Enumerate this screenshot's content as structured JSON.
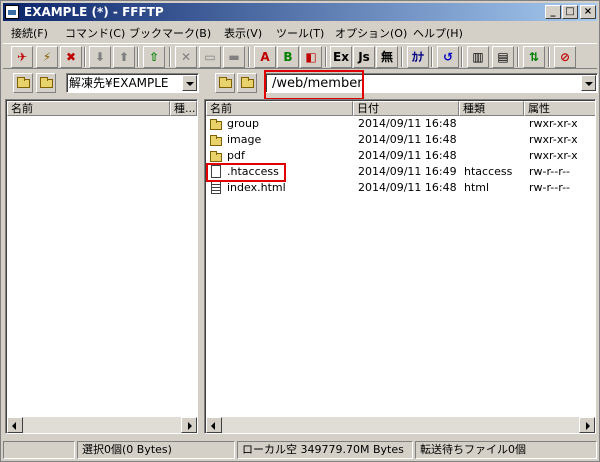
{
  "window": {
    "title": "EXAMPLE (*) - FFFTP"
  },
  "menu": [
    "接続(F)",
    "コマンド(C)",
    "ブックマーク(B)",
    "表示(V)",
    "ツール(T)",
    "オプション(O)",
    "ヘルプ(H)"
  ],
  "toolbar": {
    "buttons": [
      {
        "name": "connect-icon",
        "glyph": "✈",
        "color": "#c00000"
      },
      {
        "name": "quick-connect-icon",
        "glyph": "⚡",
        "color": "#806000"
      },
      {
        "name": "disconnect-icon",
        "glyph": "✖",
        "color": "#c00000"
      },
      {
        "name": "download-icon",
        "glyph": "⬇",
        "color": "#808080"
      },
      {
        "name": "upload-icon",
        "glyph": "⬆",
        "color": "#808080"
      },
      {
        "name": "mirror-upload-icon",
        "glyph": "⇧",
        "color": "#008000"
      },
      {
        "name": "delete-icon",
        "glyph": "✕",
        "color": "#808080"
      },
      {
        "name": "rename-icon",
        "glyph": "▭",
        "color": "#808080"
      },
      {
        "name": "new-folder-icon",
        "glyph": "▬",
        "color": "#808080"
      },
      {
        "name": "ascii-mode-icon",
        "glyph": "A",
        "color": "#c00000"
      },
      {
        "name": "binary-mode-icon",
        "glyph": "B",
        "color": "#008000"
      },
      {
        "name": "auto-mode-icon",
        "glyph": "◧",
        "color": "#c00000"
      },
      {
        "name": "ext-mode-icon",
        "glyph": "Ex",
        "color": "#000000"
      },
      {
        "name": "jis-mode-icon",
        "glyph": "Js",
        "color": "#000000"
      },
      {
        "name": "no-conversion-icon",
        "glyph": "無",
        "color": "#000000"
      },
      {
        "name": "kana-convert-icon",
        "glyph": "ｶﾅ",
        "color": "#000080"
      },
      {
        "name": "refresh-icon",
        "glyph": "↺",
        "color": "#0000c0"
      },
      {
        "name": "list-view-icon",
        "glyph": "▥",
        "color": "#000000"
      },
      {
        "name": "detail-view-icon",
        "glyph": "▤",
        "color": "#000000"
      },
      {
        "name": "sync-folders-icon",
        "glyph": "⇅",
        "color": "#008000"
      },
      {
        "name": "stop-icon",
        "glyph": "⊘",
        "color": "#c00000"
      }
    ]
  },
  "local": {
    "path": "解凍先¥EXAMPLE",
    "headers": [
      "名前",
      "種..."
    ],
    "files": []
  },
  "remote": {
    "path": "/web/member",
    "headers": [
      "名前",
      "日付",
      "種類",
      "属性"
    ],
    "files": [
      {
        "name": "group",
        "date": "2014/09/11 16:48",
        "type": "",
        "attr": "rwxr-xr-x",
        "icon": "folder"
      },
      {
        "name": "image",
        "date": "2014/09/11 16:48",
        "type": "",
        "attr": "rwxr-xr-x",
        "icon": "folder"
      },
      {
        "name": "pdf",
        "date": "2014/09/11 16:48",
        "type": "",
        "attr": "rwxr-xr-x",
        "icon": "folder"
      },
      {
        "name": ".htaccess",
        "date": "2014/09/11 16:49",
        "type": "htaccess",
        "attr": "rw-r--r--",
        "icon": "file"
      },
      {
        "name": "index.html",
        "date": "2014/09/11 16:48",
        "type": "html",
        "attr": "rw-r--r--",
        "icon": "file-lines"
      }
    ]
  },
  "status": {
    "selected": "選択0個(0 Bytes)",
    "local_free": "ローカル空 349779.70M Bytes",
    "queue": "転送待ちファイル0個"
  },
  "highlight_color": "#e00000"
}
